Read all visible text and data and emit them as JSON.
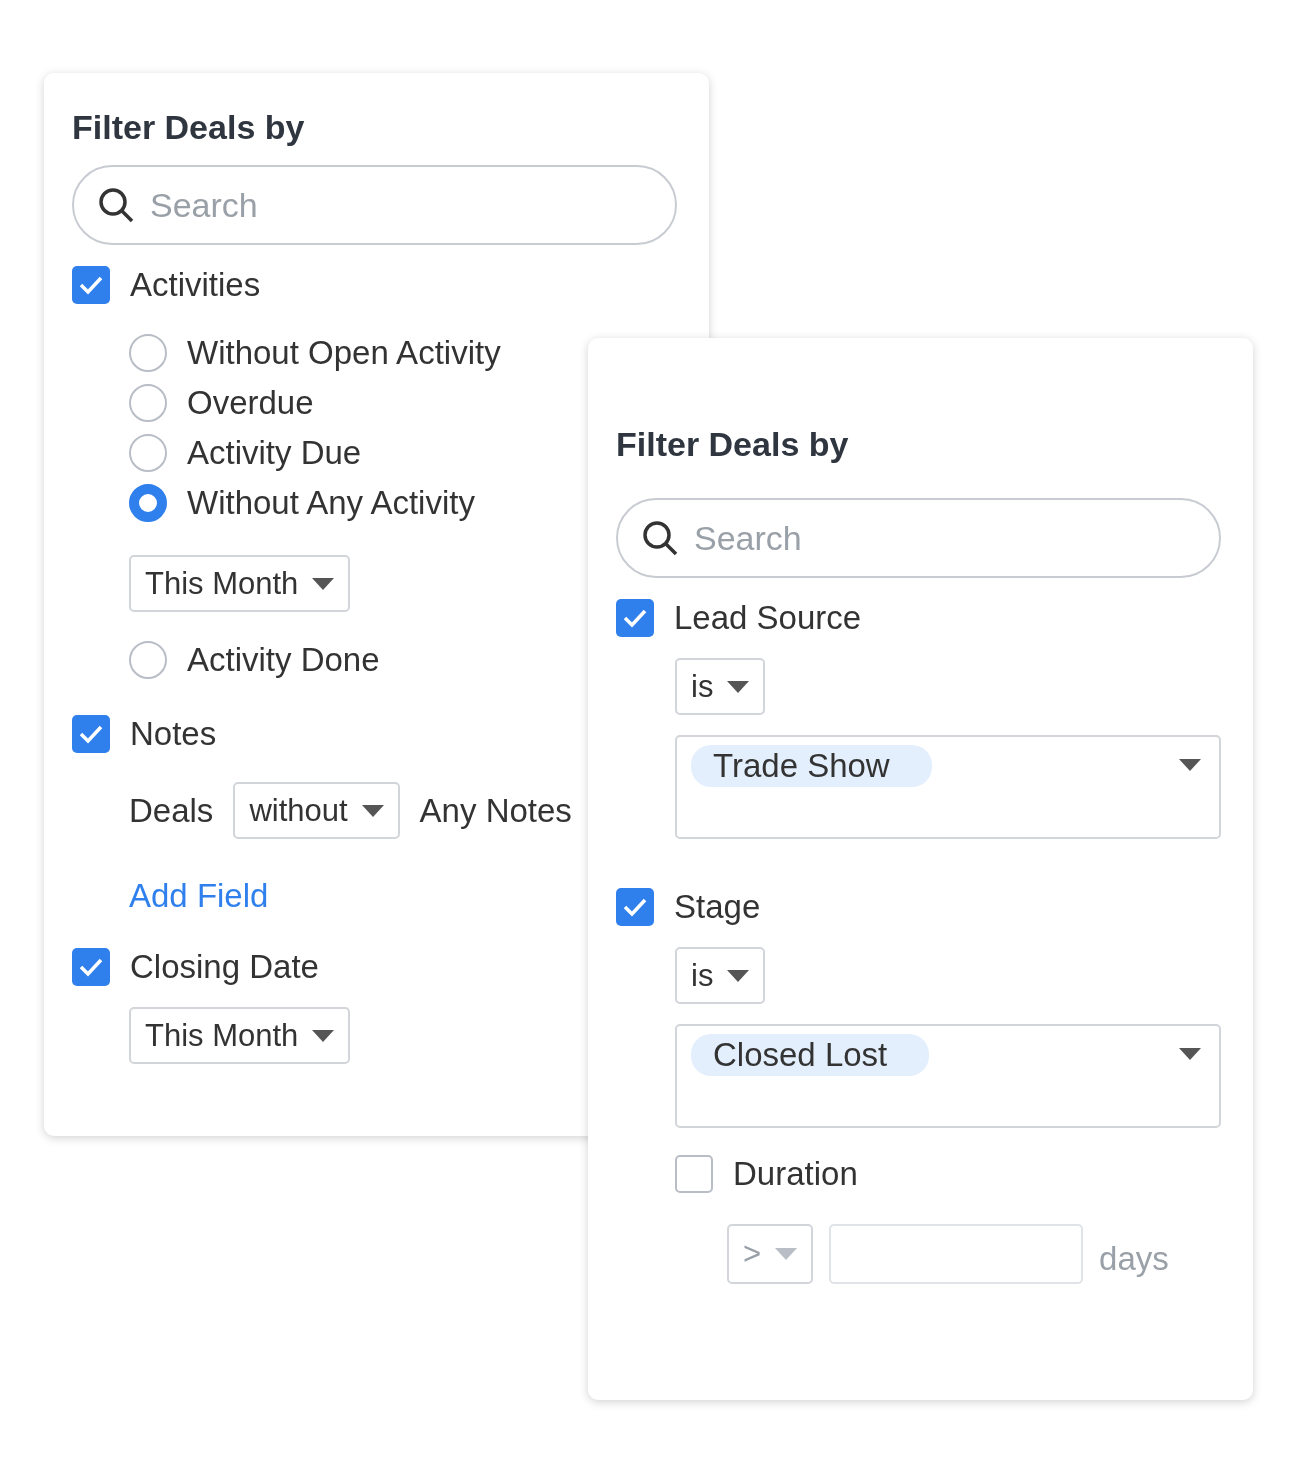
{
  "panels": [
    {
      "title": "Filter Deals by",
      "search": {
        "placeholder": "Search"
      },
      "filters": [
        {
          "kind": "checkbox",
          "label": "Activities",
          "checked": true,
          "body": [
            {
              "kind": "radio",
              "label": "Without Open Activity",
              "selected": false
            },
            {
              "kind": "radio",
              "label": "Overdue",
              "selected": false
            },
            {
              "kind": "radio",
              "label": "Activity Due",
              "selected": false
            },
            {
              "kind": "radio",
              "label": "Without Any Activity",
              "selected": true
            },
            {
              "kind": "select",
              "value": "This Month"
            },
            {
              "kind": "radio",
              "label": "Activity Done",
              "selected": false
            }
          ]
        },
        {
          "kind": "checkbox",
          "label": "Notes",
          "checked": true,
          "body": [
            {
              "kind": "sentence",
              "prefix": "Deals",
              "value": "without",
              "suffix": "Any Notes"
            }
          ]
        },
        {
          "kind": "link",
          "label": "Add Field"
        },
        {
          "kind": "checkbox",
          "label": "Closing Date",
          "checked": true,
          "body": [
            {
              "kind": "select",
              "value": "This Month"
            }
          ]
        }
      ]
    },
    {
      "title": "Filter Deals by",
      "search": {
        "placeholder": "Search"
      },
      "filters": [
        {
          "kind": "checkbox",
          "label": "Lead Source",
          "checked": true,
          "body": [
            {
              "kind": "select",
              "value": "is"
            },
            {
              "kind": "picklist",
              "tag": "Trade Show"
            }
          ]
        },
        {
          "kind": "checkbox",
          "label": "Stage",
          "checked": true,
          "body": [
            {
              "kind": "select",
              "value": "is"
            },
            {
              "kind": "picklist",
              "tag": "Closed Lost"
            },
            {
              "kind": "checkbox",
              "label": "Duration",
              "checked": false,
              "body": [
                {
                  "kind": "range",
                  "operator": ">",
                  "unit": "days",
                  "disabled": true
                }
              ]
            }
          ]
        }
      ]
    }
  ]
}
